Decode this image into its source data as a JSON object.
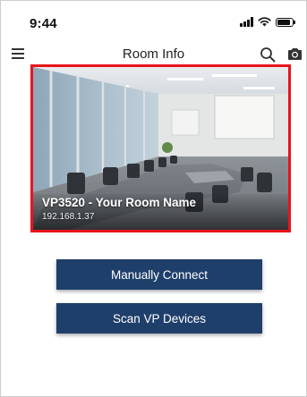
{
  "status_bar": {
    "time": "9:44",
    "icons": [
      "signal-icon",
      "wifi-icon",
      "battery-icon"
    ]
  },
  "header": {
    "title": "Room Info",
    "left_icon": "menu-icon",
    "right_icons": [
      "search-icon",
      "camera-icon"
    ]
  },
  "room_card": {
    "name": "VP3520 - Your Room Name",
    "ip": "192.168.1.37",
    "image": "conference-room-photo",
    "highlight_color": "#e8141b"
  },
  "actions": {
    "manual_connect_label": "Manually Connect",
    "scan_devices_label": "Scan VP Devices"
  },
  "colors": {
    "button_background": "#1f3f6b",
    "button_text": "#ffffff"
  }
}
